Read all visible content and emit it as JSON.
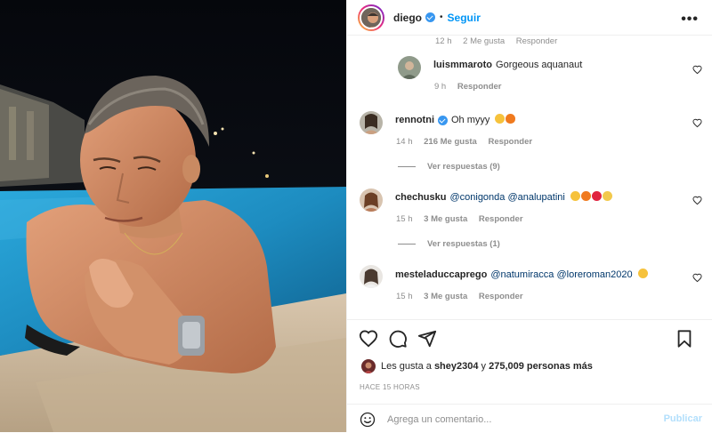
{
  "header": {
    "username": "diego",
    "separator": "•",
    "follow_label": "Seguir",
    "more_label": "•••"
  },
  "truncated_meta": {
    "time": "12 h",
    "likes": "2 Me gusta",
    "reply": "Responder"
  },
  "comments": [
    {
      "username": "luismmaroto",
      "text": "Gorgeous aquanaut",
      "time": "9 h",
      "likes": "",
      "reply": "Responder",
      "emojis": [],
      "view_replies": ""
    },
    {
      "username": "rennotni",
      "text": "Oh myyy",
      "time": "14 h",
      "likes": "216 Me gusta",
      "reply": "Responder",
      "emojis": [
        "heart-eyes-emoji",
        "fire-emoji"
      ],
      "view_replies": "Ver respuestas (9)"
    },
    {
      "username": "chechusku",
      "mentions": [
        "@conigonda",
        "@analupatini"
      ],
      "time": "15 h",
      "likes": "3 Me gusta",
      "reply": "Responder",
      "emojis": [
        "heart-eyes-emoji",
        "fire-emoji",
        "red-heart-emoji",
        "laughing-emoji"
      ],
      "view_replies": "Ver respuestas (1)"
    },
    {
      "username": "mesteladuccaprego",
      "mentions": [
        "@natumiracca",
        "@loreroman2020"
      ],
      "time": "15 h",
      "likes": "3 Me gusta",
      "reply": "Responder",
      "emojis": [
        "smiling-hearts-emoji"
      ],
      "view_replies": ""
    }
  ],
  "likes_summary": {
    "prefix": "Les gusta a",
    "user": "shey2304",
    "middle": "y",
    "count": "275,009 personas más"
  },
  "time_ago": "HACE 15 HORAS",
  "add_comment": {
    "placeholder": "Agrega un comentario...",
    "publish_label": "Publicar"
  },
  "colors": {
    "link_blue": "#0095f6",
    "mention_blue": "#00376b",
    "secondary_text": "#8e8e8e",
    "publish_disabled": "#b2dffc",
    "pool_water": "#2a9ac9"
  }
}
